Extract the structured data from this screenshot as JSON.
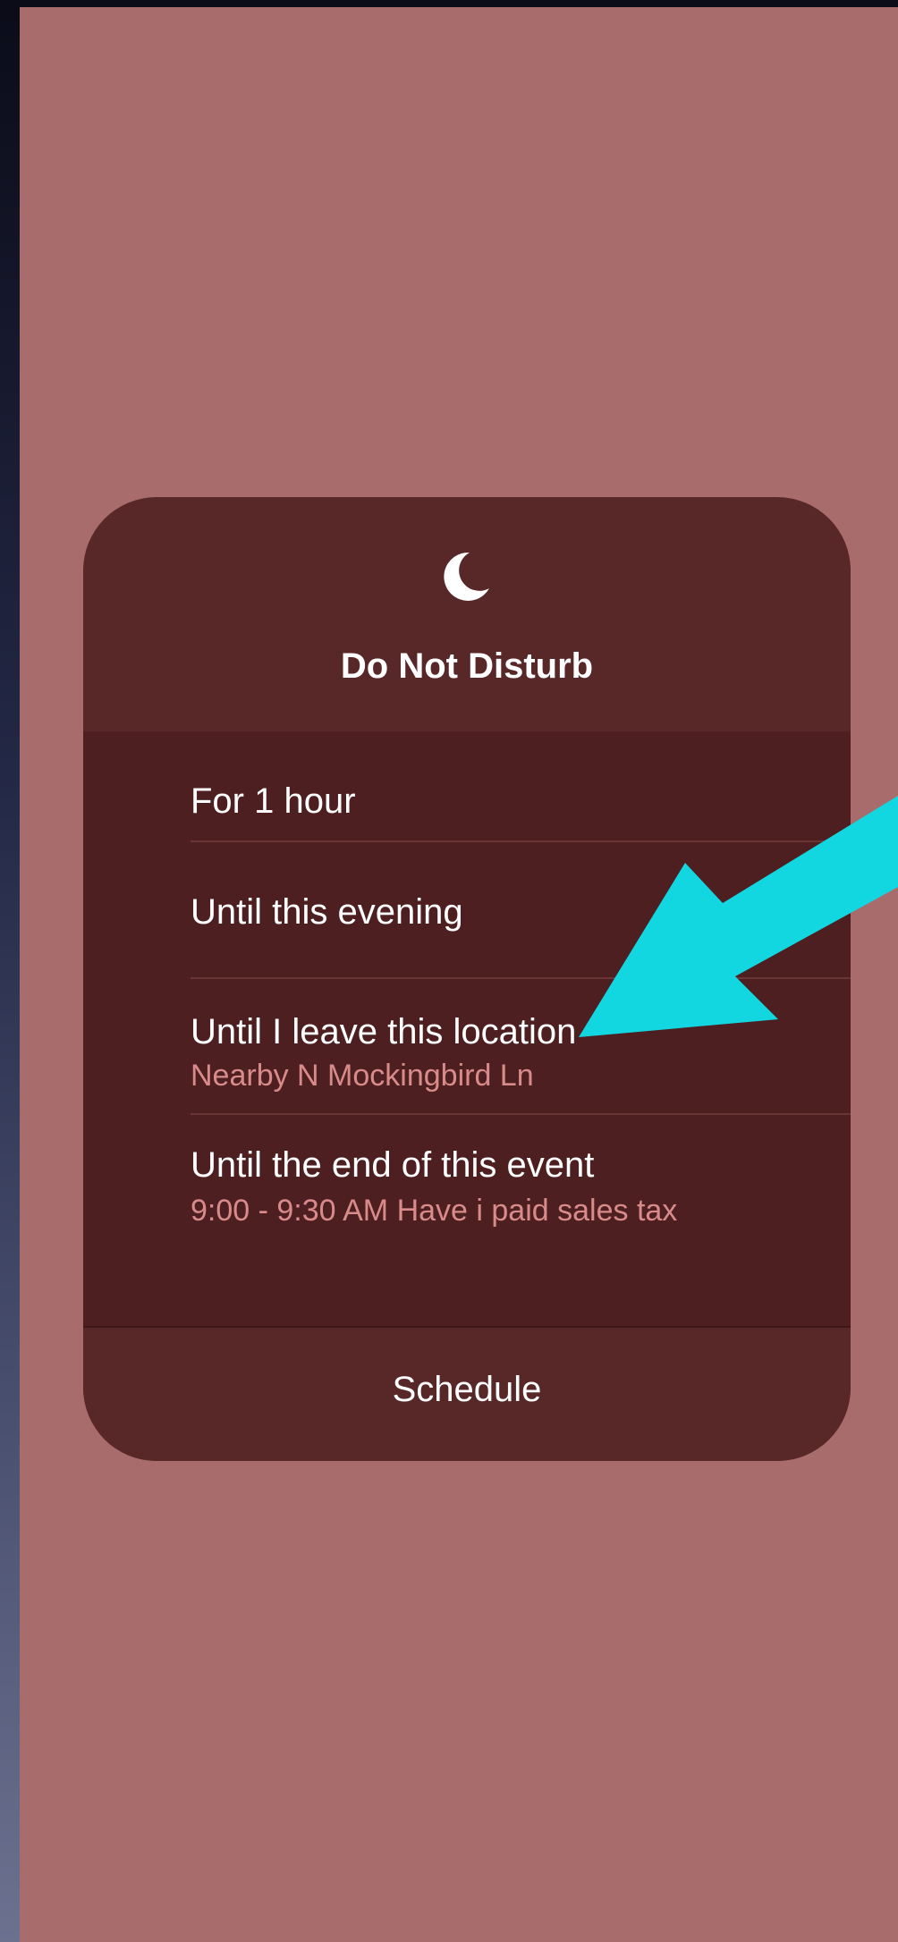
{
  "do_not_disturb": {
    "title": "Do Not Disturb",
    "options": [
      {
        "label": "For 1 hour"
      },
      {
        "label": "Until this evening"
      },
      {
        "label": "Until I leave this location",
        "detail": "Nearby N Mockingbird Ln"
      },
      {
        "label": "Until the end of this event",
        "detail": "9:00 - 9:30 AM Have i paid sales tax"
      }
    ],
    "schedule_label": "Schedule"
  },
  "colors": {
    "background": "#a96c6d",
    "panel": "#582828",
    "options_area": "#4d1f20",
    "subtitle_text": "#d88b8a",
    "annotation_arrow": "#12d6e0"
  },
  "icons": {
    "header": "moon-icon",
    "annotation": "arrow-annotation"
  }
}
